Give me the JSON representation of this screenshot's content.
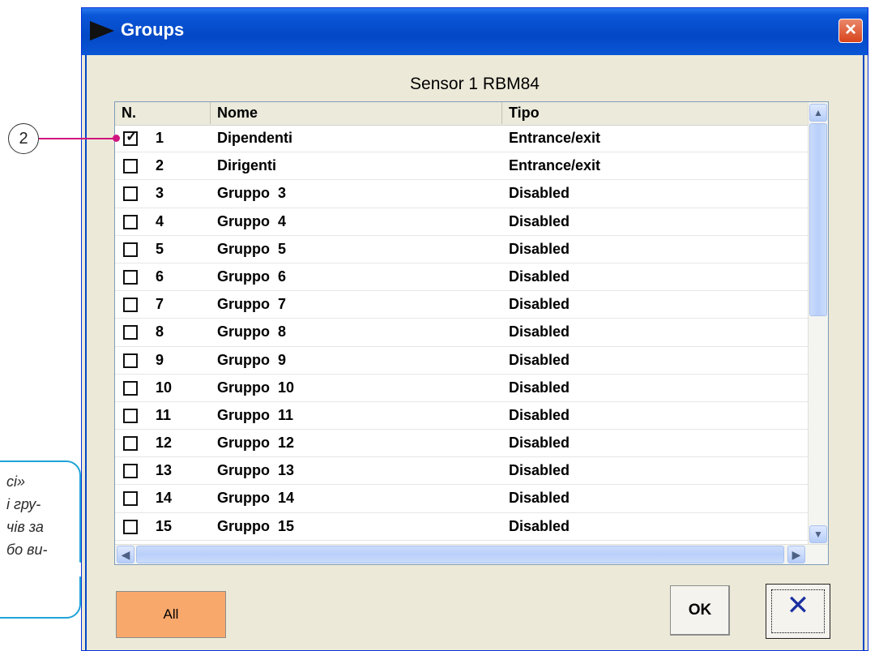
{
  "window": {
    "title": "Groups",
    "close_glyph": "×",
    "icon": "arrow-right-icon"
  },
  "sensor_title": "Sensor 1 RBM84",
  "columns": {
    "n": "N.",
    "name": "Nome",
    "type": "Tipo"
  },
  "rows": [
    {
      "n": "1",
      "name": "Dipendenti",
      "type": "Entrance/exit",
      "checked": true,
      "check_glyph": "✓"
    },
    {
      "n": "2",
      "name": "Dirigenti",
      "type": "Entrance/exit",
      "checked": false,
      "check_glyph": ""
    },
    {
      "n": "3",
      "name": "Gruppo  3",
      "type": "Disabled",
      "checked": false,
      "check_glyph": ""
    },
    {
      "n": "4",
      "name": "Gruppo  4",
      "type": "Disabled",
      "checked": false,
      "check_glyph": ""
    },
    {
      "n": "5",
      "name": "Gruppo  5",
      "type": "Disabled",
      "checked": false,
      "check_glyph": ""
    },
    {
      "n": "6",
      "name": "Gruppo  6",
      "type": "Disabled",
      "checked": false,
      "check_glyph": ""
    },
    {
      "n": "7",
      "name": "Gruppo  7",
      "type": "Disabled",
      "checked": false,
      "check_glyph": ""
    },
    {
      "n": "8",
      "name": "Gruppo  8",
      "type": "Disabled",
      "checked": false,
      "check_glyph": ""
    },
    {
      "n": "9",
      "name": "Gruppo  9",
      "type": "Disabled",
      "checked": false,
      "check_glyph": ""
    },
    {
      "n": "10",
      "name": "Gruppo  10",
      "type": "Disabled",
      "checked": false,
      "check_glyph": ""
    },
    {
      "n": "11",
      "name": "Gruppo  11",
      "type": "Disabled",
      "checked": false,
      "check_glyph": ""
    },
    {
      "n": "12",
      "name": "Gruppo  12",
      "type": "Disabled",
      "checked": false,
      "check_glyph": ""
    },
    {
      "n": "13",
      "name": "Gruppo  13",
      "type": "Disabled",
      "checked": false,
      "check_glyph": ""
    },
    {
      "n": "14",
      "name": "Gruppo  14",
      "type": "Disabled",
      "checked": false,
      "check_glyph": ""
    },
    {
      "n": "15",
      "name": "Gruppo  15",
      "type": "Disabled",
      "checked": false,
      "check_glyph": ""
    }
  ],
  "scroll": {
    "up": "▲",
    "down": "▼",
    "left": "◀",
    "right": "▶"
  },
  "buttons": {
    "all": "All",
    "ok": "OK",
    "cancel_glyph": "✕"
  },
  "annotation": {
    "marker": "2",
    "callout_text": "сі»\nі гру-\nчів за\nбо ви-"
  },
  "colors": {
    "title_bar": "#0348c6",
    "all_button": "#f9a86c",
    "marker_line": "#d0157f",
    "callout_border": "#1fa3d8"
  }
}
